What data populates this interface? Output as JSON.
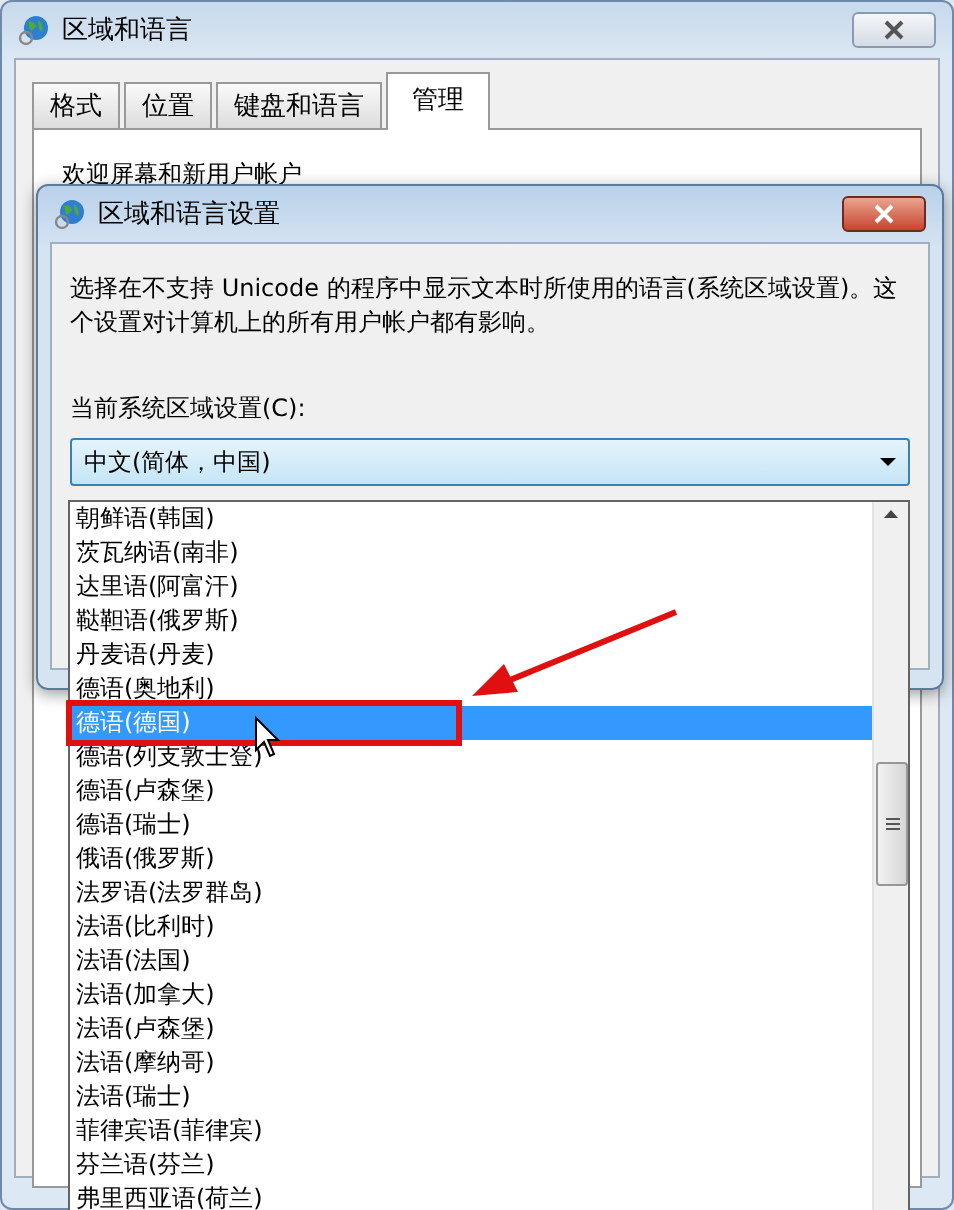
{
  "window": {
    "title": "区域和语言"
  },
  "tabs": [
    {
      "label": "格式",
      "selected": false
    },
    {
      "label": "位置",
      "selected": false
    },
    {
      "label": "键盘和语言",
      "selected": false
    },
    {
      "label": "管理",
      "selected": true
    }
  ],
  "group": {
    "title": "欢迎屏幕和新用户帐户"
  },
  "dialog": {
    "title": "区域和语言设置",
    "description": "选择在不支持 Unicode 的程序中显示文本时所使用的语言(系统区域设置)。这个设置对计算机上的所有用户帐户都有影响。",
    "field_label": "当前系统区域设置(C):",
    "dropdown": {
      "value": "中文(简体，中国)",
      "expanded": true,
      "options": [
        {
          "label": "朝鲜语(韩国)",
          "selected": false
        },
        {
          "label": "茨瓦纳语(南非)",
          "selected": false
        },
        {
          "label": "达里语(阿富汗)",
          "selected": false
        },
        {
          "label": "鞑靼语(俄罗斯)",
          "selected": false
        },
        {
          "label": "丹麦语(丹麦)",
          "selected": false
        },
        {
          "label": "德语(奥地利)",
          "selected": false
        },
        {
          "label": "德语(德国)",
          "selected": true
        },
        {
          "label": "德语(列支敦士登)",
          "selected": false
        },
        {
          "label": "德语(卢森堡)",
          "selected": false
        },
        {
          "label": "德语(瑞士)",
          "selected": false
        },
        {
          "label": "俄语(俄罗斯)",
          "selected": false
        },
        {
          "label": "法罗语(法罗群岛)",
          "selected": false
        },
        {
          "label": "法语(比利时)",
          "selected": false
        },
        {
          "label": "法语(法国)",
          "selected": false
        },
        {
          "label": "法语(加拿大)",
          "selected": false
        },
        {
          "label": "法语(卢森堡)",
          "selected": false
        },
        {
          "label": "法语(摩纳哥)",
          "selected": false
        },
        {
          "label": "法语(瑞士)",
          "selected": false
        },
        {
          "label": "菲律宾语(菲律宾)",
          "selected": false
        },
        {
          "label": "芬兰语(芬兰)",
          "selected": false
        },
        {
          "label": "弗里西亚语(荷兰)",
          "selected": false
        }
      ]
    }
  }
}
